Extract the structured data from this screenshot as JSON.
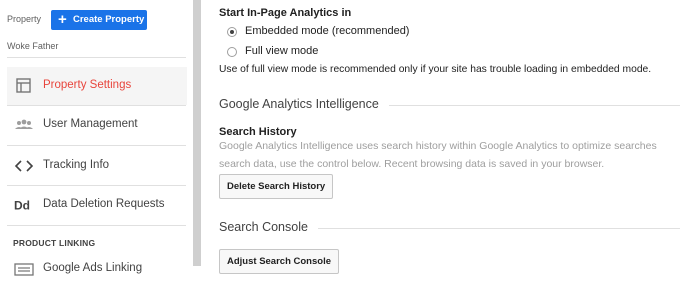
{
  "sidebar": {
    "property_label": "Property",
    "create_property_label": "Create Property",
    "account_name": "Woke Father",
    "items": [
      {
        "label": "Property Settings",
        "icon": "property-settings-icon",
        "active": true
      },
      {
        "label": "User Management",
        "icon": "users-icon",
        "active": false
      },
      {
        "label": "Tracking Info",
        "icon": "code-icon",
        "active": false
      },
      {
        "label": "Data Deletion Requests",
        "icon": "dd-icon",
        "active": false
      }
    ],
    "section_heading": "PRODUCT LINKING",
    "linking_items": [
      {
        "label": "Google Ads Linking",
        "icon": "google-ads-icon"
      }
    ]
  },
  "inpage": {
    "heading": "Start In-Page Analytics in",
    "options": [
      {
        "label": "Embedded mode (recommended)",
        "selected": true
      },
      {
        "label": "Full view mode",
        "selected": false
      }
    ],
    "note": "Use of full view mode is recommended only if your site has trouble loading in embedded mode."
  },
  "intelligence": {
    "title": "Google Analytics Intelligence",
    "subheading": "Search History",
    "desc_line1": "Google Analytics Intelligence uses search history within Google Analytics to optimize searches",
    "desc_line2": "search data, use the control below. Recent browsing data is saved in your browser.",
    "button_label": "Delete Search History"
  },
  "search_console": {
    "title": "Search Console",
    "button_label": "Adjust Search Console"
  },
  "colors": {
    "accent_blue": "#1a73e8",
    "active_red": "#e8453c"
  }
}
